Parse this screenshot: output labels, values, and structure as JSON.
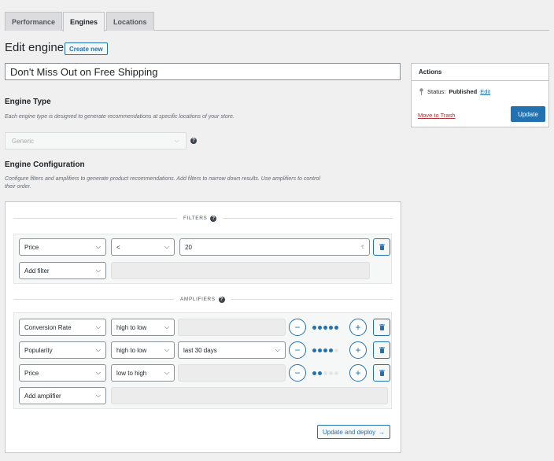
{
  "tabs": [
    {
      "label": "Performance",
      "active": false
    },
    {
      "label": "Engines",
      "active": true
    },
    {
      "label": "Locations",
      "active": false
    }
  ],
  "header": {
    "title": "Edit engine",
    "create_label": "Create new"
  },
  "engine_title": "Don't Miss Out on Free Shipping",
  "engine_type": {
    "heading": "Engine Type",
    "description": "Each engine type is designed to generate recommendations at specific locations of your store.",
    "selected": "Generic",
    "help_icon": "help-icon"
  },
  "engine_config": {
    "heading": "Engine Configuration",
    "description_line1": "Configure filters and amplifiers to generate product recommendations. Add filters to narrow down results. Use amplifiers to control",
    "description_line2": "their order."
  },
  "filters": {
    "label": "FILTERS",
    "rows": [
      {
        "field": "Price",
        "operator": "<",
        "value": "20",
        "unit": "€"
      }
    ],
    "add_label": "Add filter"
  },
  "amplifiers": {
    "label": "AMPLIFIERS",
    "rows": [
      {
        "field": "Conversion Rate",
        "order": "high to low",
        "period": "",
        "level": 5,
        "max": 5
      },
      {
        "field": "Popularity",
        "order": "high to low",
        "period": "last 30 days",
        "level": 4,
        "max": 5
      },
      {
        "field": "Price",
        "order": "low to high",
        "period": "",
        "level": 2,
        "max": 5
      }
    ],
    "add_label": "Add amplifier"
  },
  "deploy_label": "Update and deploy",
  "actions": {
    "heading": "Actions",
    "status_label": "Status:",
    "status_value": "Published",
    "edit_label": "Edit",
    "trash_label": "Move to Trash",
    "update_label": "Update"
  },
  "colors": {
    "accent": "#2271b1",
    "danger": "#b32d2e",
    "background": "#f0f0f1"
  }
}
